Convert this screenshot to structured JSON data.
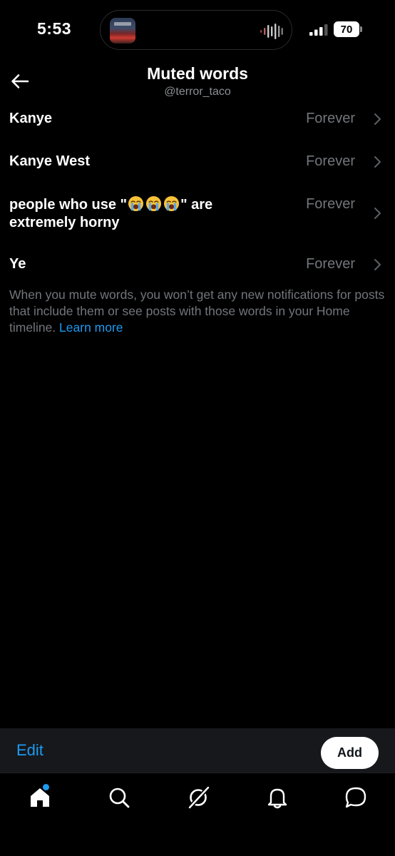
{
  "status_bar": {
    "time": "5:53",
    "battery_level": "70"
  },
  "header": {
    "title": "Muted words",
    "handle": "@terror_taco"
  },
  "muted_words": [
    {
      "word_parts": [
        "Kanye"
      ],
      "duration": "Forever"
    },
    {
      "word_parts": [
        "Kanye West"
      ],
      "duration": "Forever"
    },
    {
      "word_parts": [
        "people who use \"",
        "\" are",
        "extremely horny"
      ],
      "emoji": "loudly-crying-face",
      "emoji_count": 3,
      "duration": "Forever"
    },
    {
      "word_parts": [
        "Ye"
      ],
      "duration": "Forever"
    }
  ],
  "info": {
    "text": "When you mute words, you won’t get any new notifications for posts that include them or see posts with those words in your Home timeline.",
    "link": "Learn more"
  },
  "actions": {
    "edit_label": "Edit",
    "add_label": "Add"
  },
  "tabs": [
    {
      "icon": "home-icon",
      "has_notification_dot": true
    },
    {
      "icon": "search-icon"
    },
    {
      "icon": "grok-icon"
    },
    {
      "icon": "bell-icon"
    },
    {
      "icon": "messages-icon"
    }
  ],
  "colors": {
    "accent": "#1d9bf0",
    "secondary_text": "#71767b",
    "background": "#000000",
    "action_bar": "#16181c"
  }
}
